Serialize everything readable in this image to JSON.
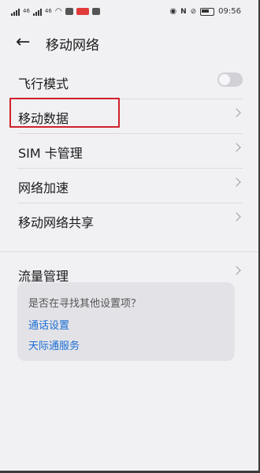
{
  "status_bar": {
    "left_label_1": "46",
    "left_label_2": "46",
    "time": "09:56"
  },
  "header": {
    "back_glyph": "←",
    "title": "移动网络"
  },
  "rows": [
    {
      "label": "飞行模式",
      "control": "toggle",
      "toggle_on": false
    },
    {
      "label": "移动数据",
      "control": "chevron",
      "highlighted": true
    },
    {
      "label": "SIM 卡管理",
      "control": "chevron"
    },
    {
      "label": "网络加速",
      "control": "chevron"
    },
    {
      "label": "移动网络共享",
      "control": "chevron"
    },
    {
      "label": "流量管理",
      "control": "chevron"
    }
  ],
  "suggestions": {
    "question": "是否在寻找其他设置项？",
    "links": [
      "通话设置",
      "天际通服务"
    ]
  },
  "colors": {
    "highlight_border": "#d0212a",
    "link": "#1a6fd6",
    "background": "#f1f0f3"
  }
}
